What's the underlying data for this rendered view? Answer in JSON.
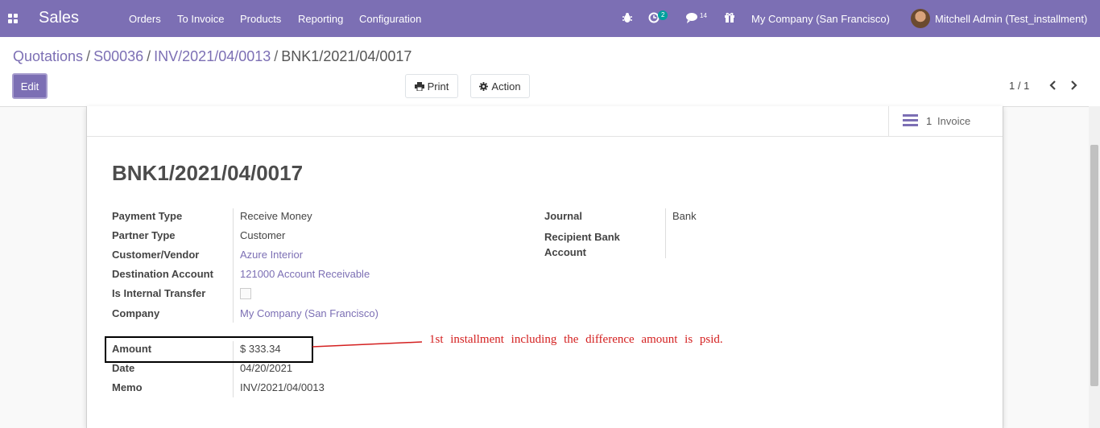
{
  "app": {
    "name": "Sales",
    "menu": [
      "Orders",
      "To Invoice",
      "Products",
      "Reporting",
      "Configuration"
    ],
    "activity_count": "2",
    "message_count": "14",
    "company": "My Company (San Francisco)",
    "user": "Mitchell Admin (Test_installment)",
    "icons": [
      "apps-grid-icon",
      "bug-icon",
      "clock-icon",
      "chat-icon",
      "gift-icon"
    ]
  },
  "breadcrumb": {
    "items": [
      "Quotations",
      "S00036",
      "INV/2021/04/0013"
    ],
    "current": "BNK1/2021/04/0017"
  },
  "toolbar": {
    "edit_label": "Edit",
    "print_label": "Print",
    "action_label": "Action",
    "pager": "1 / 1"
  },
  "smart_button": {
    "count": "1",
    "label": "Invoice"
  },
  "record": {
    "title": "BNK1/2021/04/0017",
    "left_fields": [
      {
        "label": "Payment Type",
        "value": "Receive Money"
      },
      {
        "label": "Partner Type",
        "value": "Customer"
      },
      {
        "label": "Customer/Vendor",
        "value": "Azure Interior"
      },
      {
        "label": "Destination Account",
        "value": "121000 Account Receivable"
      },
      {
        "label": "Is Internal Transfer",
        "value": ""
      },
      {
        "label": "Company",
        "value": "My Company (San Francisco)"
      }
    ],
    "right_fields": [
      {
        "label": "Journal",
        "value": "Bank"
      },
      {
        "label": "Recipient Bank Account",
        "value": ""
      }
    ],
    "bottom_fields": [
      {
        "label": "Amount",
        "value": "$ 333.34"
      },
      {
        "label": "Date",
        "value": "04/20/2021"
      },
      {
        "label": "Memo",
        "value": "INV/2021/04/0013"
      }
    ],
    "internal_transfer_checked": false
  },
  "annotation": {
    "text": "1st installment including the difference amount is psid.",
    "color": "#d42020"
  },
  "colors": {
    "brand": "#7c6fb4",
    "badge": "#00a09d"
  }
}
